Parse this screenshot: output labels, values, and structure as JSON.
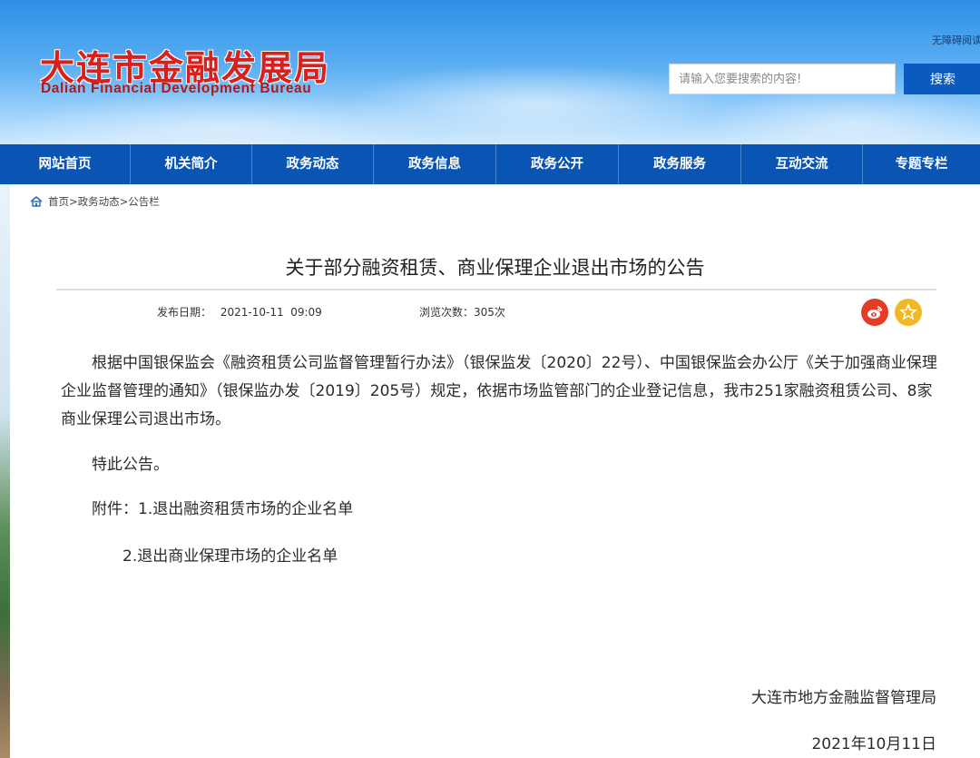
{
  "header": {
    "site_name_cn": "大连市金融发展局",
    "site_name_en": "Dalian Financial Development Bureau",
    "accessibility_link": "无障碍阅读",
    "search": {
      "placeholder": "请输入您要搜索的内容!",
      "button_label": "搜索"
    }
  },
  "nav": {
    "items": [
      {
        "label": "网站首页"
      },
      {
        "label": "机关简介"
      },
      {
        "label": "政务动态"
      },
      {
        "label": "政务信息"
      },
      {
        "label": "政务公开"
      },
      {
        "label": "政务服务"
      },
      {
        "label": "互动交流"
      },
      {
        "label": "专题专栏"
      }
    ]
  },
  "breadcrumb": {
    "icon": "home-icon",
    "text": "首页>政务动态>公告栏"
  },
  "article": {
    "title": "关于部分融资租赁、商业保理企业退出市场的公告",
    "publish_label": "发布日期：",
    "publish_date": "2021-10-11  09:09",
    "views_label": "浏览次数：",
    "views_count": "305次",
    "body": [
      "根据中国银保监会《融资租赁公司监督管理暂行办法》（银保监发〔2020〕22号）、中国银保监会办公厅《关于加强商业保理企业监督管理的通知》（银保监办发〔2019〕205号）规定，依据市场监管部门的企业登记信息，我市251家融资租赁公司、8家商业保理公司退出市场。",
      "特此公告。",
      "附件：1.退出融资租赁市场的企业名单",
      "2.退出商业保理市场的企业名单"
    ],
    "signature_org": "大连市地方金融监督管理局",
    "signature_date": "2021年10月11日"
  },
  "share": {
    "weibo_icon": "weibo-icon",
    "favorite_icon": "star-icon"
  },
  "colors": {
    "nav_bg": "#0a55b4",
    "logo_red": "#d9201c",
    "search_button": "#0a5bbd",
    "weibo": "#e63b25",
    "favorite": "#f2b824"
  }
}
